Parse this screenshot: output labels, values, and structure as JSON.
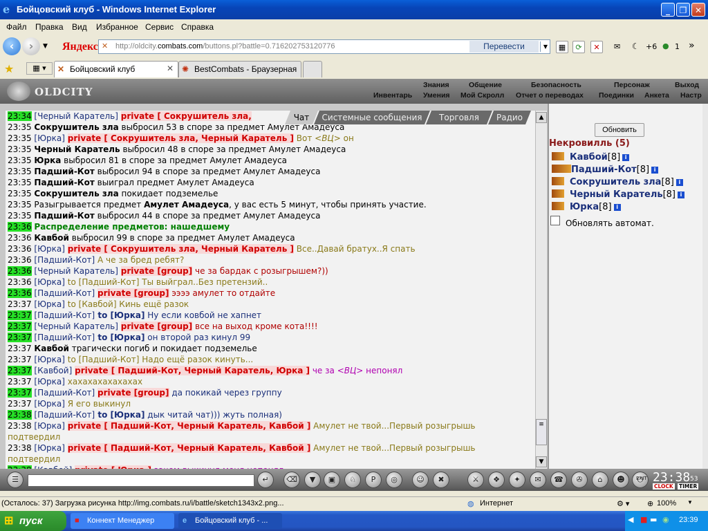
{
  "window": {
    "title": "Бойцовский клуб - Windows Internet Explorer"
  },
  "menu": [
    "Файл",
    "Правка",
    "Вид",
    "Избранное",
    "Сервис",
    "Справка"
  ],
  "address": {
    "brand": "Яндекс",
    "url_prefix": "http://oldcity.",
    "url_domain": "combats.com",
    "url_suffix": "/buttons.pl?battle=0.716202753120776",
    "translate_label": "Перевести",
    "extra": "+6",
    "count": "1"
  },
  "tabs": [
    {
      "label": "Бойцовский клуб",
      "active": true
    },
    {
      "label": "BestCombats - Браузерная ...",
      "active": false
    }
  ],
  "game": {
    "logo": "OLDCITY",
    "top_links": [
      "Знания",
      "Общение",
      "Безопасность",
      "Персонаж",
      "Выход"
    ],
    "sub_links": [
      "Инвентарь",
      "Умения",
      "Мой Скролл",
      "Отчет о переводах",
      "Поединки",
      "Анкета",
      "Настр"
    ]
  },
  "chat_tabs": [
    "Чат",
    "Системные сообщения",
    "Торговля",
    "Радио"
  ],
  "chat": [
    {
      "time": "23:34",
      "hl": true,
      "parts": [
        [
          "nick",
          "[Черный Каратель]"
        ],
        [
          "sp",
          " "
        ],
        [
          "prv",
          "private [ Сокрушитель зла, "
        ]
      ]
    },
    {
      "time": "23:35",
      "parts": [
        [
          "nmb",
          "Сокрушитель зла"
        ],
        [
          "txt",
          " выбросил 53 в споре за предмет Амулет Амадеуса"
        ]
      ]
    },
    {
      "time": "23:35",
      "parts": [
        [
          "nick",
          "[Юрка]"
        ],
        [
          "sp",
          " "
        ],
        [
          "prv",
          "private [ Сокрушитель зла, Черный Каратель ]"
        ],
        [
          "msg",
          " Вот "
        ],
        [
          "msgi",
          "<ВЦ>"
        ],
        [
          "msg",
          " он"
        ]
      ]
    },
    {
      "time": "23:35",
      "parts": [
        [
          "nmb",
          "Черный Каратель"
        ],
        [
          "txt",
          " выбросил 48 в споре за предмет Амулет Амадеуса"
        ]
      ]
    },
    {
      "time": "23:35",
      "parts": [
        [
          "nmb",
          "Юрка"
        ],
        [
          "txt",
          " выбросил 81 в споре за предмет Амулет Амадеуса"
        ]
      ]
    },
    {
      "time": "23:35",
      "parts": [
        [
          "nmb",
          "Падший-Кот"
        ],
        [
          "txt",
          " выбросил 94 в споре за предмет Амулет Амадеуса"
        ]
      ]
    },
    {
      "time": "23:35",
      "parts": [
        [
          "nmb",
          "Падший-Кот"
        ],
        [
          "txt",
          " выиграл предмет Амулет Амадеуса"
        ]
      ]
    },
    {
      "time": "23:35",
      "parts": [
        [
          "nmb",
          "Сокрушитель зла"
        ],
        [
          "txt",
          " покидает подземелье"
        ]
      ]
    },
    {
      "time": "23:35",
      "parts": [
        [
          "txt",
          "Разыгрывается предмет "
        ],
        [
          "nmb",
          "Амулет Амадеуса"
        ],
        [
          "txt",
          ", у вас есть 5 минут, чтобы принять участие."
        ]
      ]
    },
    {
      "time": "23:35",
      "parts": [
        [
          "nmb",
          "Падший-Кот"
        ],
        [
          "txt",
          " выбросил 44 в споре за предмет Амулет Амадеуса"
        ]
      ]
    },
    {
      "time": "23:36",
      "hl": true,
      "parts": [
        [
          "grn",
          "Распределение предметов: нашедшему"
        ]
      ]
    },
    {
      "time": "23:36",
      "parts": [
        [
          "nmb",
          "Кавбой"
        ],
        [
          "txt",
          " выбросил 99 в споре за предмет Амулет Амадеуса"
        ]
      ]
    },
    {
      "time": "23:36",
      "parts": [
        [
          "nick",
          "[Юрка]"
        ],
        [
          "sp",
          " "
        ],
        [
          "prv",
          "private [ Сокрушитель зла, Черный Каратель ]"
        ],
        [
          "msg",
          " Все..Давай братух..Я спать"
        ]
      ]
    },
    {
      "time": "23:36",
      "parts": [
        [
          "nick",
          "[Падший-Кот]"
        ],
        [
          "msg",
          " А че за бред ребят?"
        ]
      ]
    },
    {
      "time": "23:36",
      "hl": true,
      "parts": [
        [
          "nick",
          "[Черный Каратель]"
        ],
        [
          "sp",
          " "
        ],
        [
          "prv",
          "private [group]"
        ],
        [
          "msgr",
          " че за бардак с розыгрышем?))"
        ]
      ]
    },
    {
      "time": "23:36",
      "parts": [
        [
          "nick",
          "[Юрка]"
        ],
        [
          "to",
          " to [Падший-Кот] Ты выйграл..Без претензий.."
        ]
      ]
    },
    {
      "time": "23:36",
      "hl": true,
      "parts": [
        [
          "nick",
          "[Падший-Кот]"
        ],
        [
          "sp",
          " "
        ],
        [
          "prv",
          "private [group]"
        ],
        [
          "msgr",
          " ээээ амулет то отдайте"
        ]
      ]
    },
    {
      "time": "23:37",
      "parts": [
        [
          "nick",
          "[Юрка]"
        ],
        [
          "to",
          " to [Кавбой] Кинь ещё разок"
        ]
      ]
    },
    {
      "time": "23:37",
      "hl": true,
      "parts": [
        [
          "nick",
          "[Падший-Кот]"
        ],
        [
          "tob",
          " to [Юрка]"
        ],
        [
          "nickc",
          " Ну если ковбой не хапнет"
        ]
      ]
    },
    {
      "time": "23:37",
      "hl": true,
      "parts": [
        [
          "nick",
          "[Черный Каратель]"
        ],
        [
          "sp",
          " "
        ],
        [
          "prv",
          "private [group]"
        ],
        [
          "msgr",
          " все на выход кроме кота!!!!"
        ]
      ]
    },
    {
      "time": "23:37",
      "hl": true,
      "parts": [
        [
          "nick",
          "[Падший-Кот]"
        ],
        [
          "tob",
          " to [Юрка]"
        ],
        [
          "nickc",
          " он второй раз кинул 99"
        ]
      ]
    },
    {
      "time": "23:37",
      "parts": [
        [
          "nmb",
          "Кавбой"
        ],
        [
          "txt",
          " трагически погиб и покидает подземелье"
        ]
      ]
    },
    {
      "time": "23:37",
      "parts": [
        [
          "nick",
          "[Юрка]"
        ],
        [
          "to",
          " to [Падший-Кот] Надо ещё разок кинуть..."
        ]
      ]
    },
    {
      "time": "23:37",
      "hl": true,
      "parts": [
        [
          "nick",
          "[Кавбой]"
        ],
        [
          "sp",
          " "
        ],
        [
          "prv",
          "private [ Падший-Кот, Черный Каратель, Юрка ]"
        ],
        [
          "msgp",
          " че за "
        ],
        [
          "msgpi",
          "<ВЦ>"
        ],
        [
          "msgp",
          " непонял"
        ]
      ]
    },
    {
      "time": "23:37",
      "parts": [
        [
          "nick",
          "[Юрка]"
        ],
        [
          "msg",
          " хахахахахахахах"
        ]
      ]
    },
    {
      "time": "23:37",
      "hl": true,
      "parts": [
        [
          "nick",
          "[Падший-Кот]"
        ],
        [
          "sp",
          " "
        ],
        [
          "prv",
          "private [group]"
        ],
        [
          "nickc",
          " да покикай через группу"
        ]
      ]
    },
    {
      "time": "23:37",
      "parts": [
        [
          "nick",
          "[Юрка]"
        ],
        [
          "msg",
          " Я его выкинул"
        ]
      ]
    },
    {
      "time": "23:38",
      "hl": true,
      "parts": [
        [
          "nick",
          "[Падший-Кот]"
        ],
        [
          "tob",
          " to [Юрка]"
        ],
        [
          "nickc",
          " дык читай чат))) жуть полная)"
        ]
      ]
    },
    {
      "time": "23:38",
      "parts": [
        [
          "nick",
          "[Юрка]"
        ],
        [
          "sp",
          " "
        ],
        [
          "prv",
          "private [ Падший-Кот, Черный Каратель, Кавбой ]"
        ],
        [
          "msg",
          " Амулет не твой...Первый розыгрышь"
        ]
      ],
      "cont": "подтвердил"
    },
    {
      "time": "23:38",
      "parts": [
        [
          "nick",
          "[Юрка]"
        ],
        [
          "sp",
          " "
        ],
        [
          "prv",
          "private [ Падший-Кот, Черный Каратель, Кавбой ]"
        ],
        [
          "msg",
          " Амулет не твой...Первый розыгрышь"
        ]
      ],
      "cont": "подтвердил"
    },
    {
      "time": "23:38",
      "hl": true,
      "parts": [
        [
          "nick",
          "[Кавбой]"
        ],
        [
          "sp",
          " "
        ],
        [
          "prv",
          "private [ Юрка ]"
        ],
        [
          "msgp",
          " зачем выкинул меня непонял"
        ]
      ]
    }
  ],
  "panel": {
    "refresh_label": "Обновить",
    "group_title": "Некровилль (5)",
    "members": [
      {
        "name": "Кавбой",
        "level": "[8]"
      },
      {
        "name": "Падший-Кот",
        "level": "[8]"
      },
      {
        "name": "Сокрушитель зла",
        "level": "[8]"
      },
      {
        "name": "Черный Каратель",
        "level": "[8]"
      },
      {
        "name": "Юрка",
        "level": "[8]"
      }
    ],
    "auto_label": "Обновлять автомат."
  },
  "clock": {
    "time": "23:38",
    "seconds": "53",
    "clock_btn": "CLOCK",
    "timer_btn": "TIMER",
    "exit_label": "EXIT"
  },
  "status": {
    "text": "(Осталось: 37) Загрузка рисунка http://img.combats.ru/i/battle/sketch1343x2.png...",
    "zone": "Интернет",
    "zoom": "100%"
  },
  "taskbar": {
    "start": "пуск",
    "items": [
      {
        "label": "Коннект Менеджер",
        "active": false
      },
      {
        "label": "Бойцовский клуб - ...",
        "active": true
      }
    ],
    "time": "23:39"
  },
  "colors": {
    "highlight": "#26e026",
    "private": "#d00000",
    "nick": "#1a2f7a",
    "group": "#8a1a1a"
  }
}
